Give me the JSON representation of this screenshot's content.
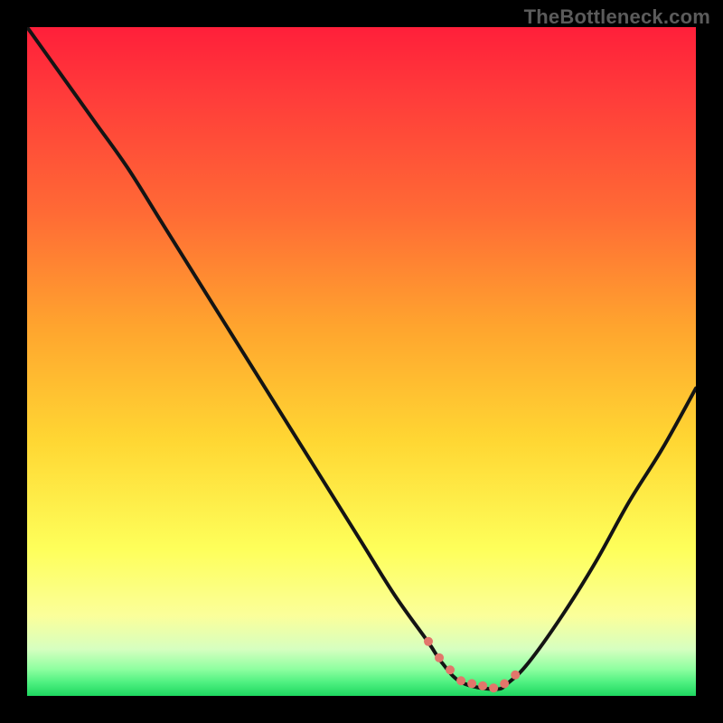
{
  "watermark": {
    "text": "TheBottleneck.com"
  },
  "colors": {
    "red": "#ff1f3a",
    "orange": "#ffb02a",
    "yellow": "#feff60",
    "yellow_light": "#fdffb0",
    "green_light": "#9effa0",
    "green": "#28e060",
    "curve": "#141414",
    "dots": "#e2766b",
    "background": "#000000"
  },
  "chart_data": {
    "type": "line",
    "title": "",
    "xlabel": "",
    "ylabel": "",
    "ylim": [
      0,
      100
    ],
    "xlim": [
      0,
      100
    ],
    "series": [
      {
        "name": "bottleneck-curve",
        "x": [
          0,
          5,
          10,
          15,
          20,
          25,
          30,
          35,
          40,
          45,
          50,
          55,
          60,
          62,
          65,
          70,
          72,
          75,
          80,
          85,
          90,
          95,
          100
        ],
        "values": [
          100,
          93,
          86,
          79,
          71,
          63,
          55,
          47,
          39,
          31,
          23,
          15,
          8,
          5,
          2,
          1,
          2,
          5,
          12,
          20,
          29,
          37,
          46
        ]
      }
    ],
    "flat_region": {
      "x_start": 60,
      "x_end": 73
    },
    "annotations": [
      {
        "type": "watermark",
        "text": "TheBottleneck.com",
        "position": "top-right"
      }
    ]
  }
}
